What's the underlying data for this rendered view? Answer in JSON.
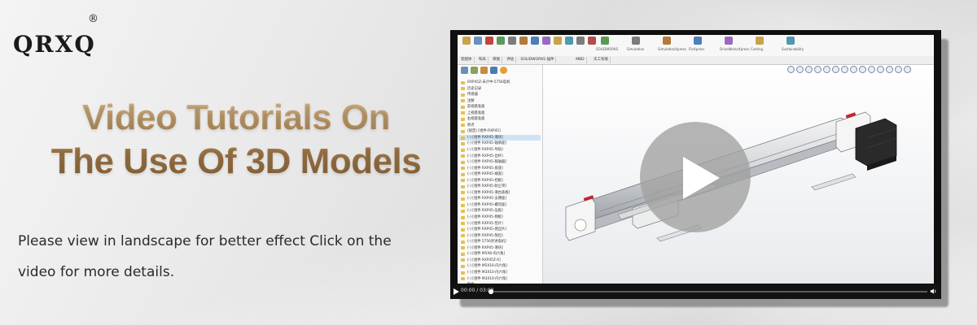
{
  "brand": {
    "logo": "QRXQ",
    "mark": "®"
  },
  "headline": {
    "line1": "Video Tutorials On",
    "line2": "The Use Of 3D Models"
  },
  "subtitle": {
    "line1": "Please view in landscape for better effect Click on the",
    "line2": "video for more details."
  },
  "video": {
    "time": "00:00 / 03:09",
    "progress": 0,
    "play_icon": "play-icon",
    "volume_icon": "volume-icon",
    "ribbon": {
      "labels": [
        "SOLIDWORKS",
        "Simulation",
        "SimulationXpress",
        "FloXpress",
        "DriveWorksXpress",
        "Costing",
        "Sustainability"
      ]
    },
    "tabs": [
      "装配体",
      "布局",
      "草图",
      "评估",
      "SOLIDWORKS 插件",
      "MBD",
      "天工有限"
    ],
    "tree_rows": [
      "RXP45Z-未计中-5756电机",
      "历史记录",
      "传感器",
      "注解",
      "前视基准面",
      "上视基准面",
      "右视基准面",
      "原点",
      "(固定) [组件-RXP45]",
      "(-) [组件 RXP45-滑块]",
      "(-) [组件 RXP45-轴承座]",
      "(-) [组件 RXP45-导轨]",
      "(-) [组件 RXP45-丝杆]",
      "(-) [组件 RXP45-联轴器]",
      "(-) [组件 RXP45-底座]",
      "(-) [组件 RXP45-端盖]",
      "(-) [组件 RXP45-挡板]",
      "(-) [组件 RXP45-防尘带]",
      "(-) [组件 RXP45-滑台盖板]",
      "(-) [组件 RXP45-支撑座]",
      "(-) [组件 RXP45-螺母座]",
      "(-) [组件 RXP45-压板]",
      "(-) [组件 RXP45-侧板]",
      "(-) [组件 RXP45-垫片]",
      "(-) [组件 RXP45-感应片]",
      "(-) [组件 RXP45-限位]",
      "(-) [组件 5756步进电机]",
      "(-) [组件 RXP45-滑块]",
      "(-) [组件 M5X8-内六角]",
      "(-) [组件 RXP45Z-X]",
      "(-) [组件 M5X16-内六角]",
      "(-) [组件 M3X10-内六角]",
      "(-) [组件 M3X10-内六角]",
      "配合"
    ]
  },
  "colors": {
    "headline_gold": "#a77e4d",
    "background": "#e3e3e3",
    "player_bar": "#121212"
  }
}
